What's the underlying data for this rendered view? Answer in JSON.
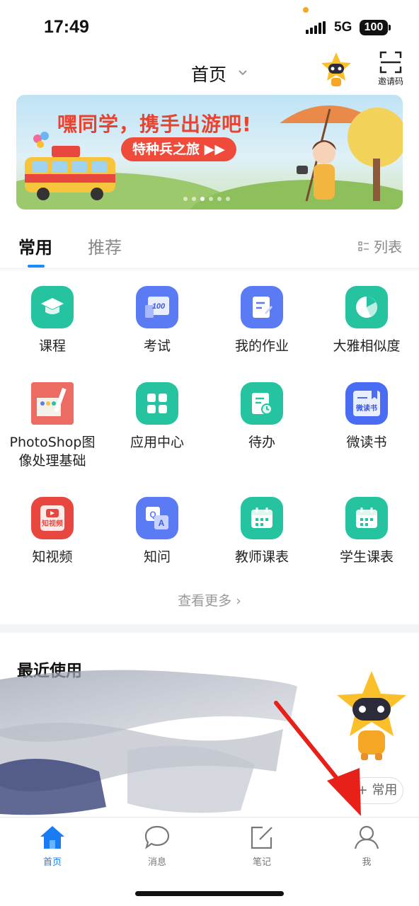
{
  "status_bar": {
    "time": "17:49",
    "network": "5G",
    "battery": "100"
  },
  "header": {
    "title": "首页",
    "invite_label": "邀请码"
  },
  "banner": {
    "headline": "嘿同学，携手出游吧!",
    "tag": "特种兵之旅 ▶▶",
    "slide_count": 6,
    "active_slide": 3
  },
  "tabs": {
    "common": "常用",
    "recommend": "推荐",
    "list_toggle": "列表"
  },
  "apps": [
    {
      "label": "课程",
      "icon": "graduation-cap-icon",
      "color": "#25c3a0"
    },
    {
      "label": "考试",
      "icon": "exam-icon",
      "color": "#5b7bf5"
    },
    {
      "label": "我的作业",
      "icon": "homework-icon",
      "color": "#5b7bf5"
    },
    {
      "label": "大雅相似度",
      "icon": "similarity-icon",
      "color": "#25c3a0"
    },
    {
      "label": "PhotoShop图像处理基础",
      "icon": "course-cover-icon",
      "color": "#e85d55"
    },
    {
      "label": "应用中心",
      "icon": "app-grid-icon",
      "color": "#25c3a0"
    },
    {
      "label": "待办",
      "icon": "todo-icon",
      "color": "#25c3a0"
    },
    {
      "label": "微读书",
      "icon": "book-icon",
      "color": "#4a6cf5"
    },
    {
      "label": "知视频",
      "icon": "video-icon",
      "color": "#e8473f"
    },
    {
      "label": "知问",
      "icon": "qa-icon",
      "color": "#5b7bf5"
    },
    {
      "label": "教师课表",
      "icon": "calendar-icon",
      "color": "#25c3a0"
    },
    {
      "label": "学生课表",
      "icon": "calendar-icon",
      "color": "#25c3a0"
    }
  ],
  "app_badges": {
    "exam": "100",
    "book": "微读书",
    "video": "知视频"
  },
  "more_label": "查看更多",
  "recent": {
    "title": "最近使用",
    "add_common": "+ 常用"
  },
  "bottom_nav": [
    {
      "label": "首页",
      "icon": "home-icon",
      "active": true
    },
    {
      "label": "消息",
      "icon": "message-icon",
      "active": false
    },
    {
      "label": "笔记",
      "icon": "note-icon",
      "active": false
    },
    {
      "label": "我",
      "icon": "profile-icon",
      "active": false
    }
  ],
  "colors": {
    "accent": "#1a7cf5",
    "teal": "#25c3a0",
    "indigo": "#5b7bf5",
    "arrow": "#e8201a"
  }
}
